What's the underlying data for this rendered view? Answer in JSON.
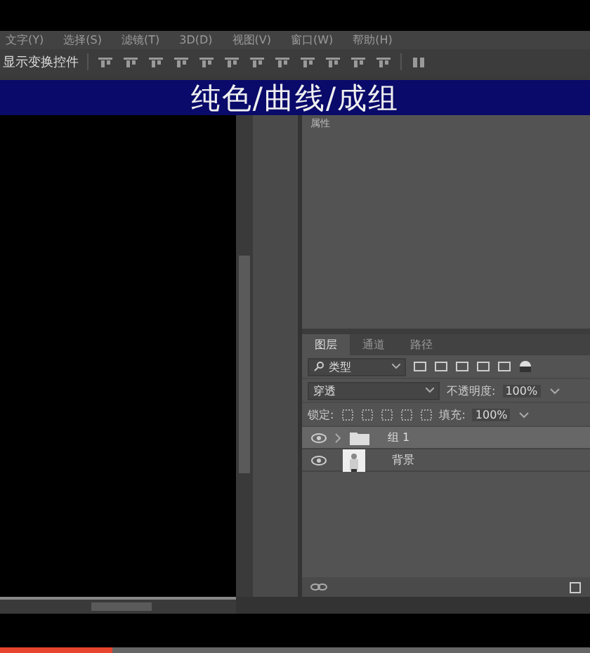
{
  "menu": [
    "文字(Y)",
    "选择(S)",
    "滤镜(T)",
    "3D(D)",
    "视图(V)",
    "窗口(W)",
    "帮助(H)"
  ],
  "options_bar": {
    "label": "显示变换控件"
  },
  "banner": {
    "title": "纯色/曲线/成组"
  },
  "properties_panel": {
    "title": "属性"
  },
  "layers_panel": {
    "tabs": [
      {
        "label": "图层",
        "selected": true
      },
      {
        "label": "通道",
        "selected": false
      },
      {
        "label": "路径",
        "selected": false
      }
    ],
    "filter": "类型",
    "blend_mode": "穿透",
    "opacity_label": "不透明度:",
    "opacity": "100%",
    "lock_label": "锁定:",
    "fill_label": "填充:",
    "fill": "100%",
    "layers": [
      {
        "name": "组 1",
        "kind": "group",
        "selected": true,
        "visible": true
      },
      {
        "name": "背景",
        "selected": false,
        "visible": true
      }
    ]
  },
  "video_progress": {
    "level": 0.19
  }
}
